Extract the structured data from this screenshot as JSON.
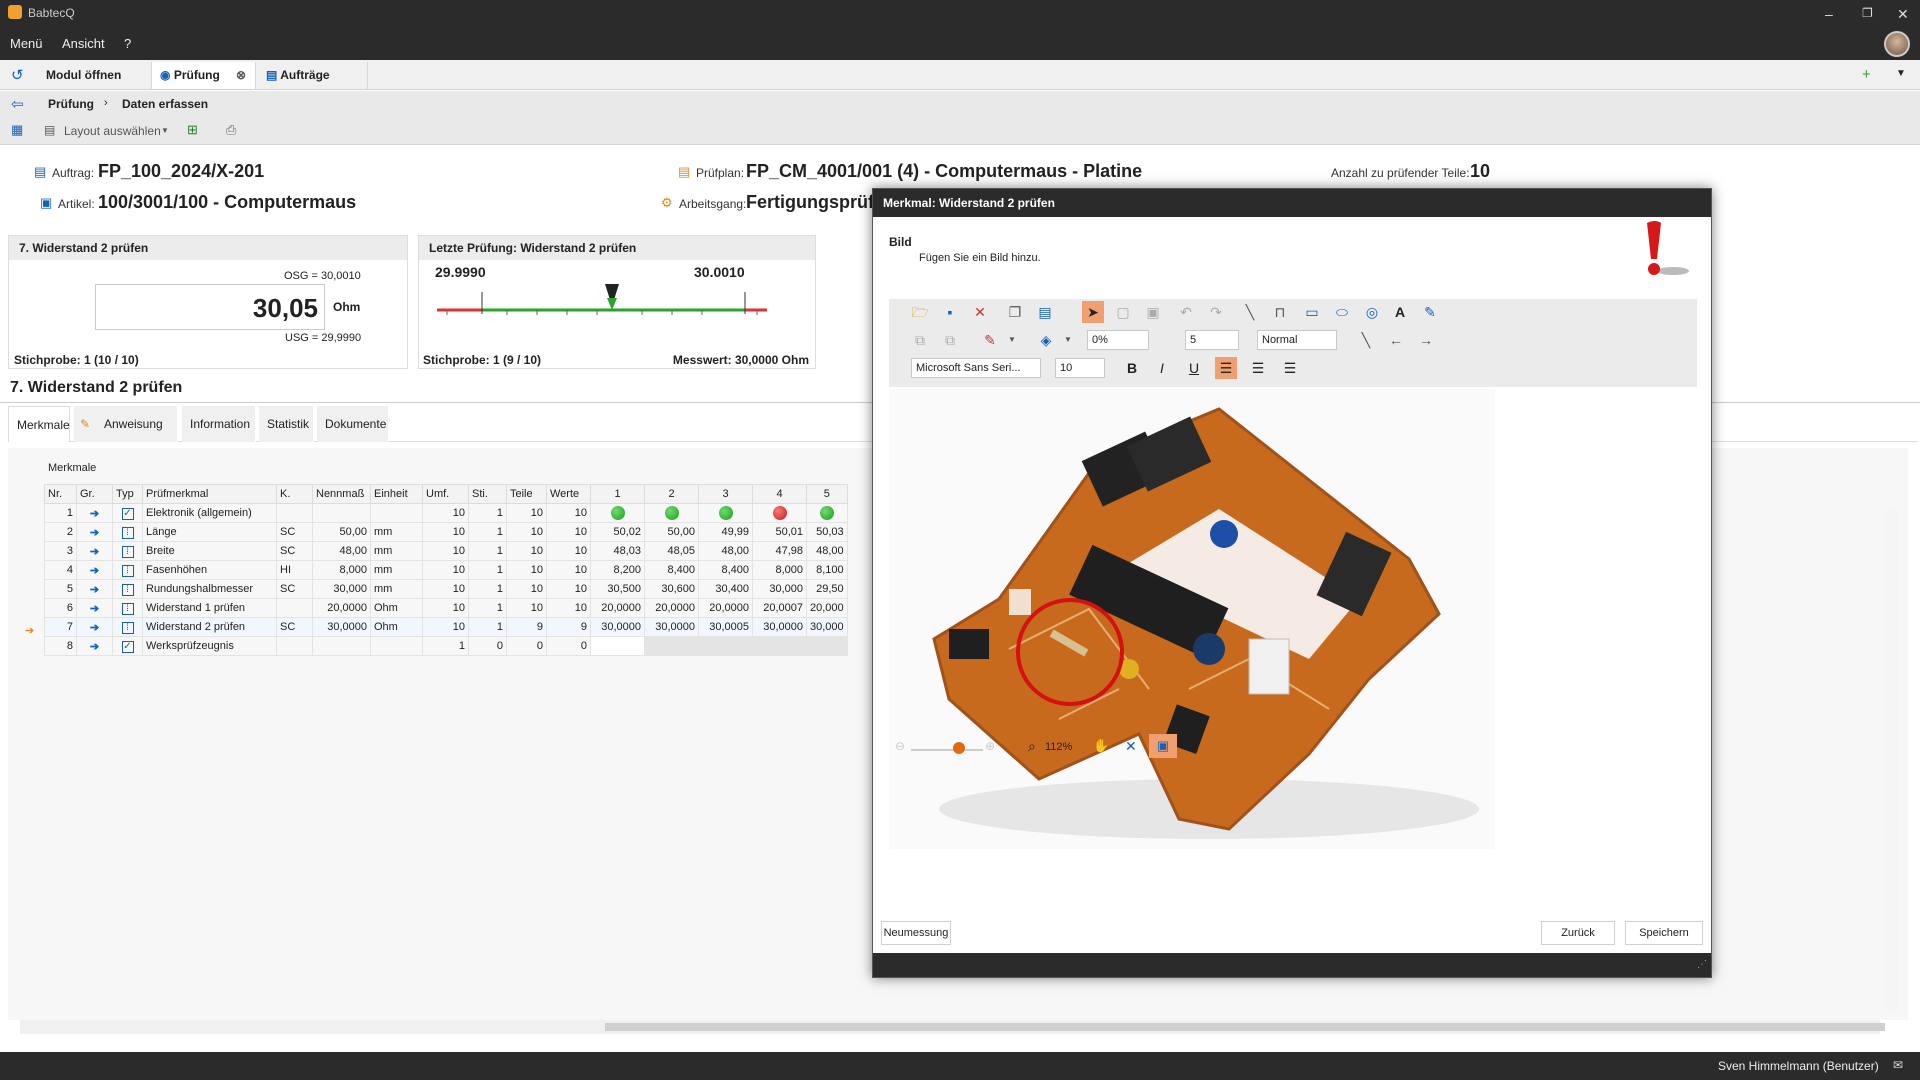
{
  "app": {
    "title": "BabtecQ",
    "user": "Sven Himmelmann (Benutzer)"
  },
  "menu": [
    "Menü",
    "Ansicht",
    "?"
  ],
  "module_tabs": [
    {
      "label": "Modul öffnen"
    },
    {
      "label": "Prüfung"
    },
    {
      "label": "Aufträge"
    }
  ],
  "breadcrumb": {
    "root": "Prüfung",
    "current": "Daten erfassen"
  },
  "toolbar": {
    "layout_label": "Layout auswählen"
  },
  "header": {
    "auftrag_label": "Auftrag:",
    "auftrag": "FP_100_2024/X-201",
    "artikel_label": "Artikel:",
    "artikel": "100/3001/100 - Computermaus",
    "pruefplan_label": "Prüfplan:",
    "pruefplan": "FP_CM_4001/001 (4) - Computermaus - Platine",
    "arbeitsgang_label": "Arbeitsgang:",
    "arbeitsgang": "Fertigungsprüfu",
    "anzahl_label": "Anzahl zu prüfender Teile:",
    "anzahl": "10"
  },
  "entry_panel": {
    "title": "7. Widerstand 2 prüfen",
    "osg": "OSG = 30,0010",
    "value": "30,05",
    "unit": "Ohm",
    "usg": "USG = 29,9990",
    "stichprobe": "Stichprobe: 1 (10 / 10)"
  },
  "last_panel": {
    "title": "Letzte Prüfung: Widerstand 2 prüfen",
    "low": "29.9990",
    "high": "30.0010",
    "stichprobe": "Stichprobe: 1 (9 / 10)",
    "messwert": "Messwert: 30,0000 Ohm"
  },
  "section_title": "7. Widerstand 2 prüfen",
  "inner_tabs": [
    "Merkmale",
    "Anweisung",
    "Information",
    "Statistik",
    "Dokumente"
  ],
  "grid": {
    "group_label": "Merkmale",
    "headers": [
      "Nr.",
      "Gr.",
      "Typ",
      "Prüfmerkmal",
      "K.",
      "Nennmaß",
      "Einheit",
      "Umf.",
      "Sti.",
      "Teile",
      "Werte",
      "1",
      "2",
      "3",
      "4",
      "5"
    ],
    "rows": [
      {
        "nr": "1",
        "name": "Elektronik (allgemein)",
        "k": "",
        "nenn": "",
        "einheit": "",
        "umf": "10",
        "sti": "1",
        "teile": "10",
        "werte": "10",
        "v": [
          "",
          "",
          "",
          "",
          ""
        ]
      },
      {
        "nr": "2",
        "name": "Länge",
        "k": "SC",
        "nenn": "50,00",
        "einheit": "mm",
        "umf": "10",
        "sti": "1",
        "teile": "10",
        "werte": "10",
        "v": [
          "50,02",
          "50,00",
          "49,99",
          "50,01",
          "50,03"
        ]
      },
      {
        "nr": "3",
        "name": "Breite",
        "k": "SC",
        "nenn": "48,00",
        "einheit": "mm",
        "umf": "10",
        "sti": "1",
        "teile": "10",
        "werte": "10",
        "v": [
          "48,03",
          "48,05",
          "48,00",
          "47,98",
          "48,00"
        ]
      },
      {
        "nr": "4",
        "name": "Fasenhöhen",
        "k": "HI",
        "nenn": "8,000",
        "einheit": "mm",
        "umf": "10",
        "sti": "1",
        "teile": "10",
        "werte": "10",
        "v": [
          "8,200",
          "8,400",
          "8,400",
          "8,000",
          "8,100"
        ]
      },
      {
        "nr": "5",
        "name": "Rundungshalbmesser",
        "k": "SC",
        "nenn": "30,000",
        "einheit": "mm",
        "umf": "10",
        "sti": "1",
        "teile": "10",
        "werte": "10",
        "v": [
          "30,500",
          "30,600",
          "30,400",
          "30,000",
          "29,50"
        ]
      },
      {
        "nr": "6",
        "name": "Widerstand 1 prüfen",
        "k": "",
        "nenn": "20,0000",
        "einheit": "Ohm",
        "umf": "10",
        "sti": "1",
        "teile": "10",
        "werte": "10",
        "v": [
          "20,0000",
          "20,0000",
          "20,0000",
          "20,0007",
          "20,000"
        ]
      },
      {
        "nr": "7",
        "name": "Widerstand 2 prüfen",
        "k": "SC",
        "nenn": "30,0000",
        "einheit": "Ohm",
        "umf": "10",
        "sti": "1",
        "teile": "9",
        "werte": "9",
        "v": [
          "30,0000",
          "30,0000",
          "30,0005",
          "30,0000",
          "30,000"
        ]
      },
      {
        "nr": "8",
        "name": "Werksprüfzeugnis",
        "k": "",
        "nenn": "",
        "einheit": "",
        "umf": "1",
        "sti": "0",
        "teile": "0",
        "werte": "0",
        "v": [
          "",
          "",
          "",
          "",
          ""
        ]
      }
    ],
    "row1_status": [
      "green",
      "green",
      "green",
      "red",
      "green"
    ]
  },
  "dialog": {
    "title": "Merkmal: Widerstand 2 prüfen",
    "section": "Bild",
    "hint": "Fügen Sie ein Bild hinzu.",
    "opacity": "0%",
    "width": "5",
    "linestyle": "Normal",
    "font": "Microsoft Sans Seri...",
    "fontsize": "10",
    "zoom": "112%",
    "btn_new": "Neumessung",
    "btn_back": "Zurück",
    "btn_save": "Speichern"
  }
}
